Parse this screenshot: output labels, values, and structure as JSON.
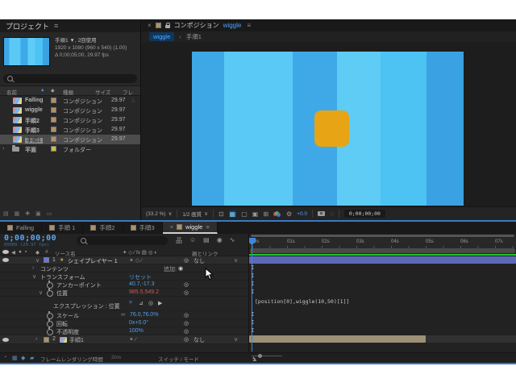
{
  "colors": {
    "accent_blue": "#4f9fe8",
    "value_red": "#d2564c",
    "cache_green": "#25c425",
    "layer1_bar": "#5b6ab8",
    "layer2_bar": "#9c9076",
    "label_tan": "#b39064",
    "label_blue": "#6b74e8",
    "square_orange": "#e7a415",
    "panel_border_blue": "#3a78c2"
  },
  "icons": {
    "menu": "≡",
    "close": "×",
    "dropdown": "∨",
    "crumb_sep": "‹",
    "sort_asc": "▲",
    "tag": "◆",
    "twirl_open": "∨",
    "twirl_closed": "›",
    "star": "★",
    "network": "∴",
    "flowchart": "品",
    "shy": "☺",
    "frame_blend": "▤",
    "motion_blur": "◉",
    "graph_editor": "∿",
    "whip": "◎",
    "add": "◉",
    "expr_enable": "=",
    "expr_graph": "⊿",
    "expr_whip": "◎",
    "expr_menu": "▶",
    "chain": "∞",
    "sel": "⊡",
    "grid": "▦",
    "mask": "▢",
    "roi": "▣",
    "guides": "⊞",
    "gear": "⚙",
    "link": "◌",
    "shy_sw": "✦",
    "collapse": "◇",
    "quality": "∕",
    "mountain": "▲",
    "hash": "#",
    "av_audio": "◀",
    "av_solo": "●",
    "av_lock": "▪",
    "switch_header": "✦ ◇ ∕ fx ▤ ◎ ◐",
    "layer1_switches": "✦ ◇ ∕",
    "layer2_switches": "✦ ∕",
    "status_1": "◔",
    "status_2": "▦",
    "status_3": "◆",
    "status_4": "▰",
    "footer_1": "▤",
    "footer_2": "▦",
    "footer_3": "✚",
    "footer_4": "▣",
    "footer_5": "▭"
  },
  "project": {
    "title": "プロジェクト",
    "preview": {
      "name_line": "手順1 ▼, 2回使用",
      "dim_line": "1920 x 1080 (960 x 540) (1.00)",
      "time_line": "Δ 0;00;05;00, 29.97 fps"
    },
    "columns": {
      "name": "名前",
      "type": "種類",
      "size": "サイズ",
      "fps": "フレ"
    },
    "rows": [
      {
        "name": "Falling",
        "type": "コンポジション",
        "fps": "29.97"
      },
      {
        "name": "wiggle",
        "type": "コンポジション",
        "fps": "29.97"
      },
      {
        "name": "手順2",
        "type": "コンポジション",
        "fps": "29.97"
      },
      {
        "name": "手順3",
        "type": "コンポジション",
        "fps": "29.97"
      },
      {
        "name": "手順1",
        "type": "コンポジション",
        "fps": "29.97"
      },
      {
        "name": "平面",
        "type": "フォルダー",
        "fps": ""
      }
    ]
  },
  "comp": {
    "tab_title": "コンポジション",
    "comp_name": "wiggle",
    "breadcrumb": {
      "current": "wiggle",
      "parent": "手順1"
    },
    "toolbar": {
      "zoom": "(33.2 %)",
      "quality": "1/2 画質",
      "exposure": "+0.0",
      "timecode": "0;00;00;00"
    },
    "canvas": {
      "stripes": [
        {
          "style": "background:#3ea7e6;width:12%"
        },
        {
          "style": "background:#5ac9f5;width:25%"
        },
        {
          "style": "background:#3fa9e8;width:16.5%"
        },
        {
          "style": "background:#5fccf6;width:16%"
        },
        {
          "style": "background:#4cc3f2;width:17%"
        },
        {
          "style": "background:#3aa2e2;width:13.5%"
        }
      ],
      "square_style": "background:#e7a415"
    }
  },
  "timeline": {
    "tabs": [
      {
        "label": "Falling"
      },
      {
        "label": "手順 1"
      },
      {
        "label": "手順2"
      },
      {
        "label": "手順3"
      },
      {
        "label": "wiggle"
      }
    ],
    "timecode": "0;00;00;00",
    "frames": "00000 (29.97 fps)",
    "headers": {
      "source": "ソース名",
      "parent": "親とリンク"
    },
    "ruler": [
      "0s",
      "01s",
      "02s",
      "03s",
      "04s",
      "05s",
      "06s",
      "07s"
    ],
    "layer1": {
      "num": "1",
      "name": "シェイプレイヤー 1",
      "parent": "なし"
    },
    "layer2": {
      "num": "2",
      "name": "手順1",
      "parent": "なし"
    },
    "props": {
      "contents": "コンテンツ",
      "add": "追加:",
      "transform": "トランスフォーム",
      "reset": "リセット",
      "anchor": "アンカーポイント",
      "anchor_value": "40.7,-17.3",
      "position": "位置",
      "position_value": "985.5,549.2",
      "expression": "エクスプレッション : 位置",
      "scale": "スケール",
      "scale_value": "76.0,76.0%",
      "rotation": "回転",
      "rotation_value": "0x+0.0°",
      "opacity": "不透明度",
      "opacity_value": "100%"
    },
    "expression_code": "[position[0],wiggle(10,50)[1]]",
    "status": {
      "render_label": "フレームレンダリング時間",
      "render_time": "3ms",
      "switches": "スイッチ / モード"
    }
  }
}
